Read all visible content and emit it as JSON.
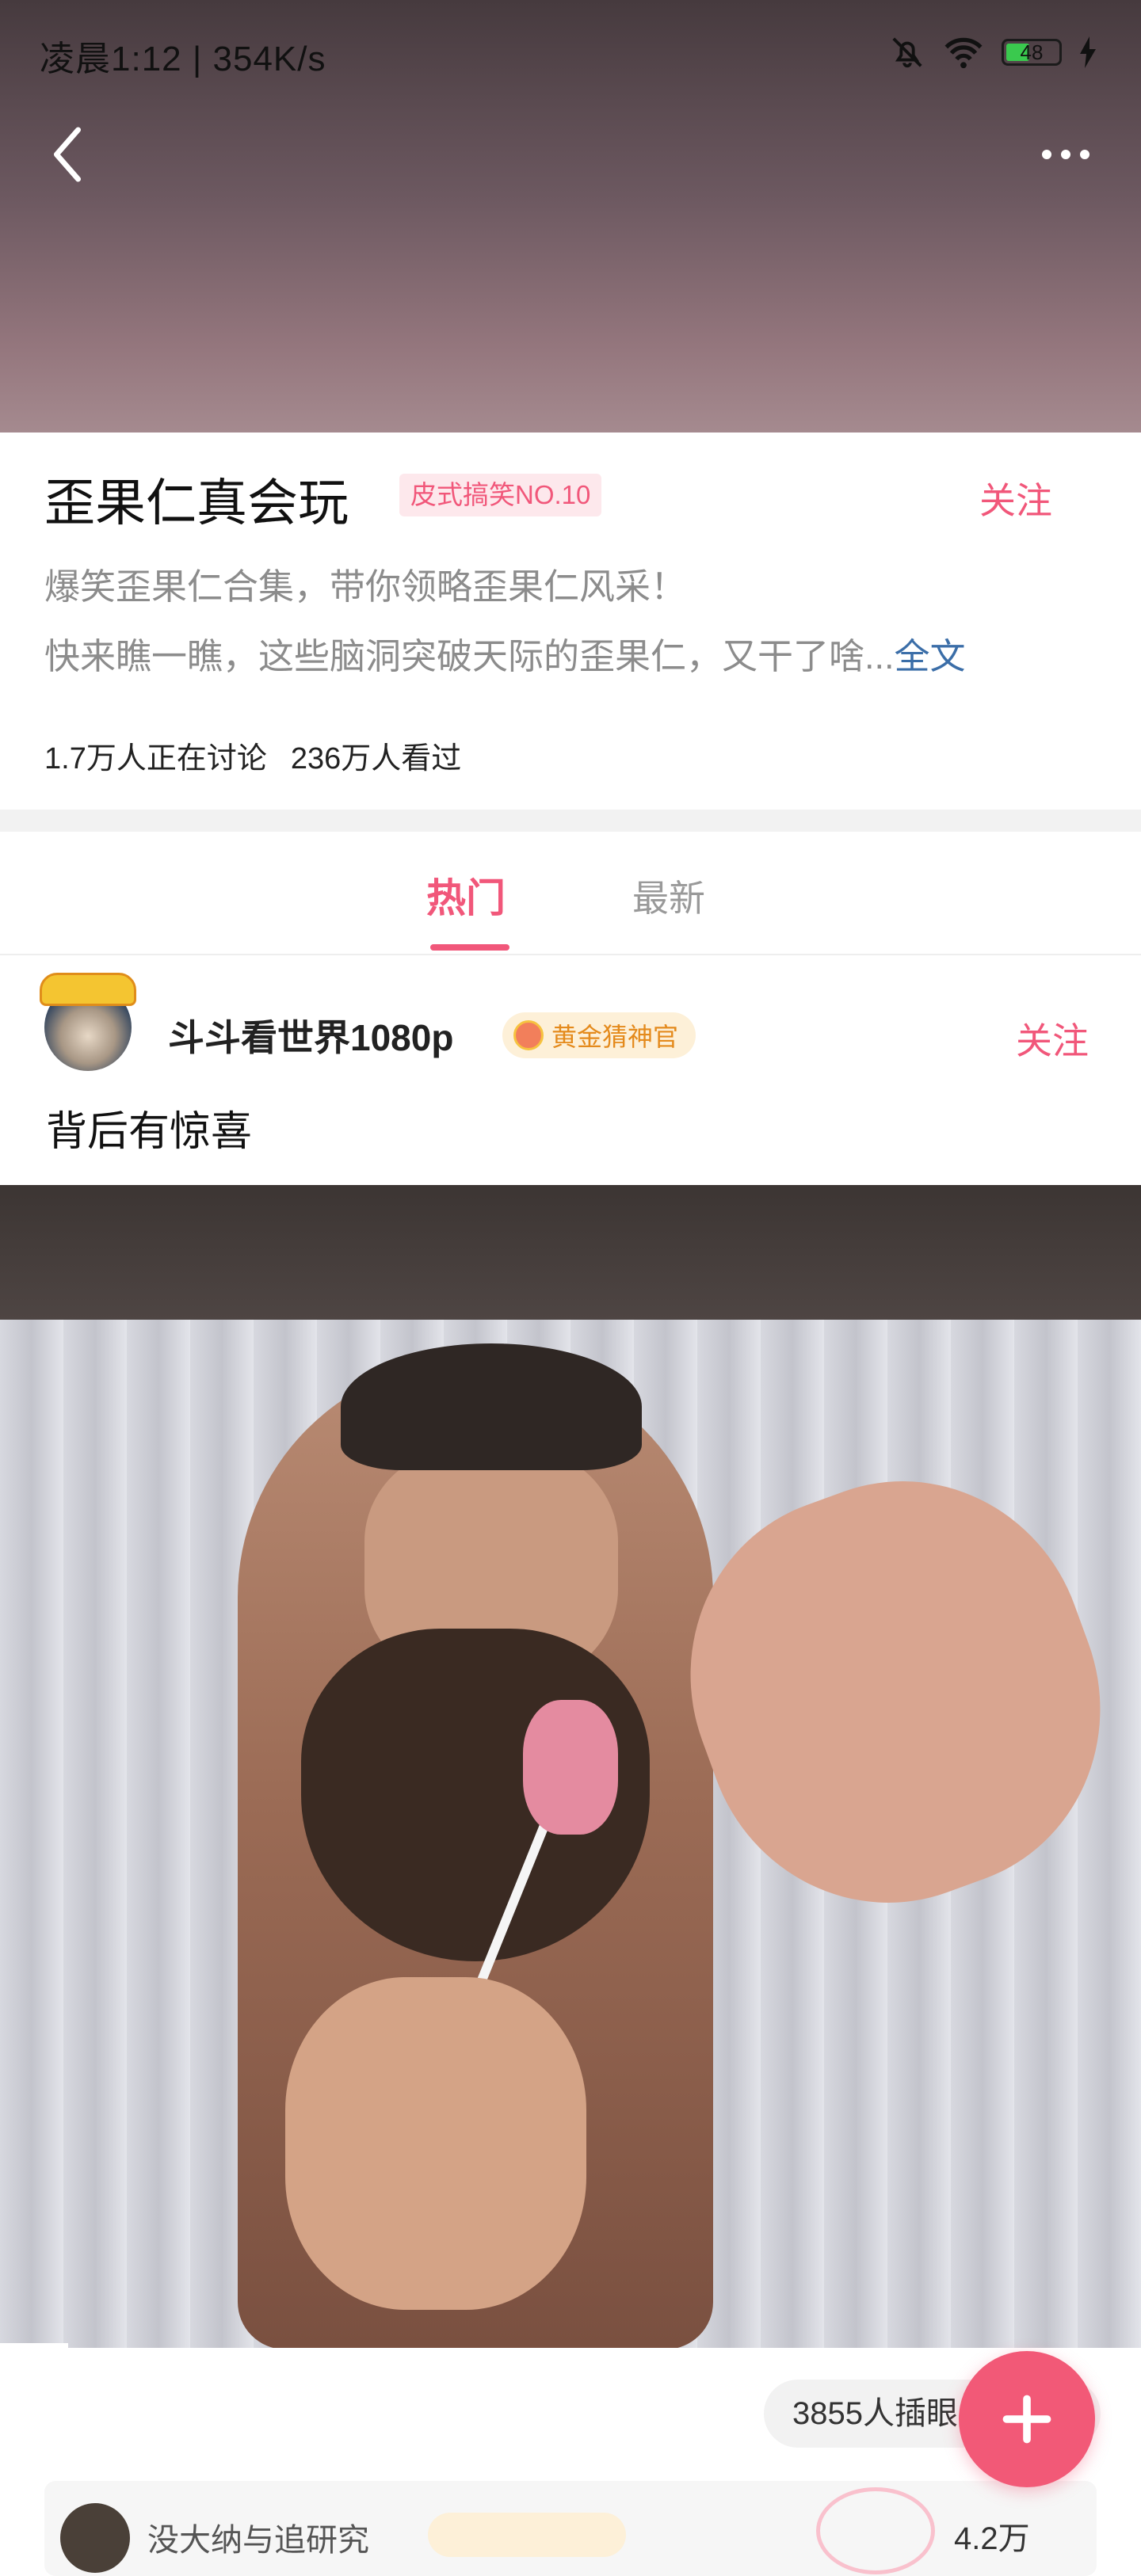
{
  "status_bar": {
    "time": "凌晨1:12 | 354K/s",
    "battery": "48"
  },
  "topic": {
    "title": "歪果仁真会玩",
    "tag": "皮式搞笑NO.10",
    "follow_label": "关注",
    "description_line1": "爆笑歪果仁合集，带你领略歪果仁风采！",
    "description_line2": "快来瞧一瞧，这些脑洞突破天际的歪果仁，又干了啥...",
    "full_text_label": "全文",
    "discussing": "1.7万人正在讨论",
    "viewed": "236万人看过"
  },
  "tabs": [
    {
      "label": "热门",
      "active": true
    },
    {
      "label": "最新",
      "active": false
    }
  ],
  "post": {
    "username": "斗斗看世界1080p",
    "badge": "黄金猜神官",
    "follow_label": "关注",
    "text": "背后有惊喜",
    "video_progress": 0.06
  },
  "footer": {
    "plug_text": "3855人插眼",
    "comment_name": "没大纳与追研究",
    "comment_count": "4.2万"
  },
  "colors": {
    "accent": "#f1577a",
    "link": "#3b6ea8",
    "badge_text": "#e48a1c"
  },
  "icons": [
    "back-icon",
    "more-icon",
    "mute-bell-icon",
    "wifi-icon",
    "battery-icon",
    "charging-icon",
    "add-icon"
  ]
}
